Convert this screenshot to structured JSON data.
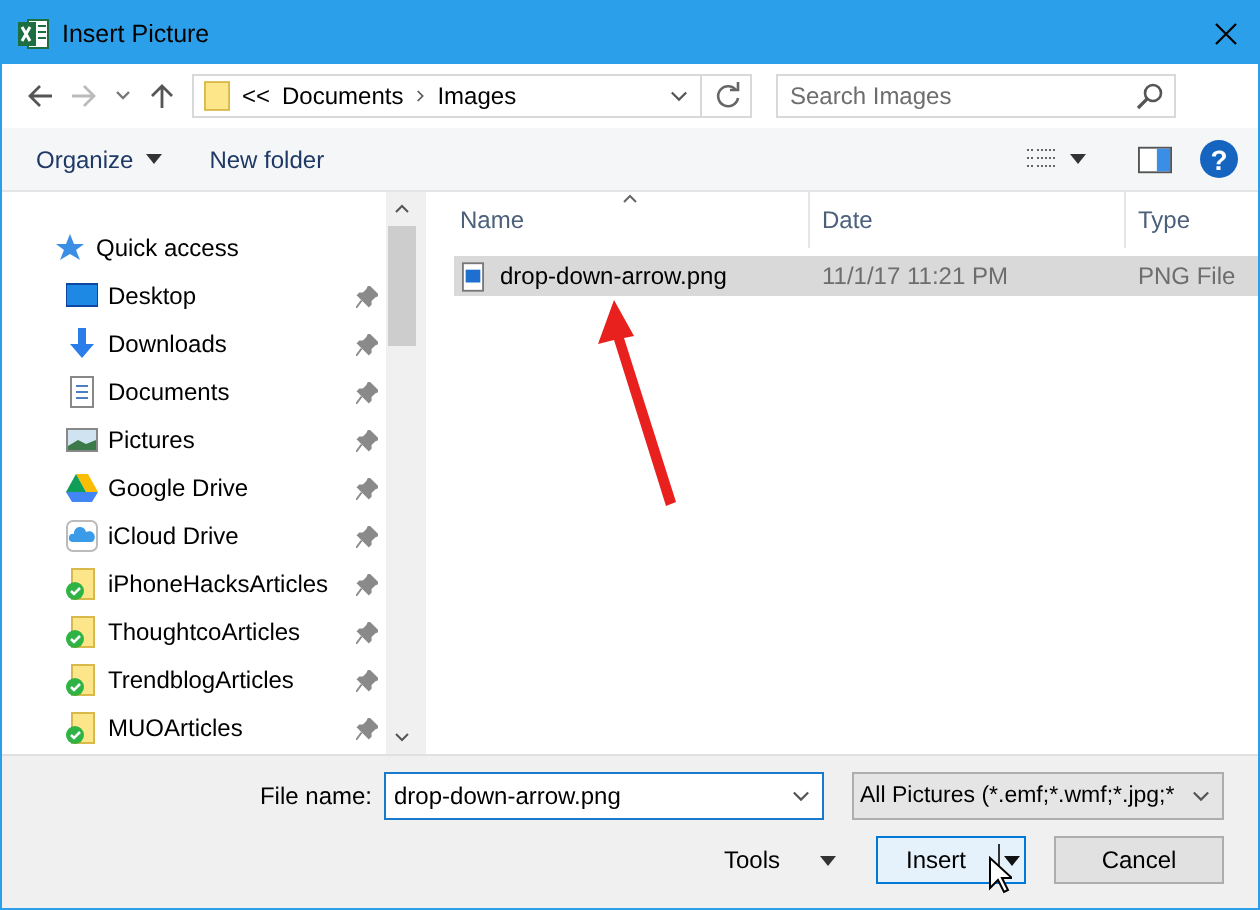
{
  "window": {
    "title": "Insert Picture"
  },
  "breadcrumb": {
    "overflow": "<<",
    "segments": [
      "Documents",
      "Images"
    ]
  },
  "search": {
    "placeholder": "Search Images"
  },
  "toolbar": {
    "organize": "Organize",
    "new_folder": "New folder",
    "help": "?"
  },
  "sidebar": {
    "header": "Quick access",
    "items": [
      {
        "label": "Desktop",
        "kind": "desktop",
        "pinned": true
      },
      {
        "label": "Downloads",
        "kind": "downloads",
        "pinned": true
      },
      {
        "label": "Documents",
        "kind": "documents",
        "pinned": true
      },
      {
        "label": "Pictures",
        "kind": "pictures",
        "pinned": true
      },
      {
        "label": "Google Drive",
        "kind": "gdrive",
        "pinned": true
      },
      {
        "label": "iCloud Drive",
        "kind": "icloud",
        "pinned": true
      },
      {
        "label": "iPhoneHacksArticles",
        "kind": "synced",
        "pinned": true
      },
      {
        "label": "ThoughtcoArticles",
        "kind": "synced",
        "pinned": true
      },
      {
        "label": "TrendblogArticles",
        "kind": "synced",
        "pinned": true
      },
      {
        "label": "MUOArticles",
        "kind": "synced",
        "pinned": true
      }
    ]
  },
  "table": {
    "columns": [
      "Name",
      "Date",
      "Type"
    ],
    "rows": [
      {
        "name": "drop-down-arrow.png",
        "date": "11/1/17 11:21 PM",
        "type": "PNG File",
        "selected": true
      }
    ]
  },
  "footer": {
    "file_name_label": "File name:",
    "file_name": "drop-down-arrow.png",
    "file_type": "All Pictures (*.emf;*.wmf;*.jpg;*",
    "tools": "Tools",
    "insert": "Insert",
    "cancel": "Cancel"
  }
}
